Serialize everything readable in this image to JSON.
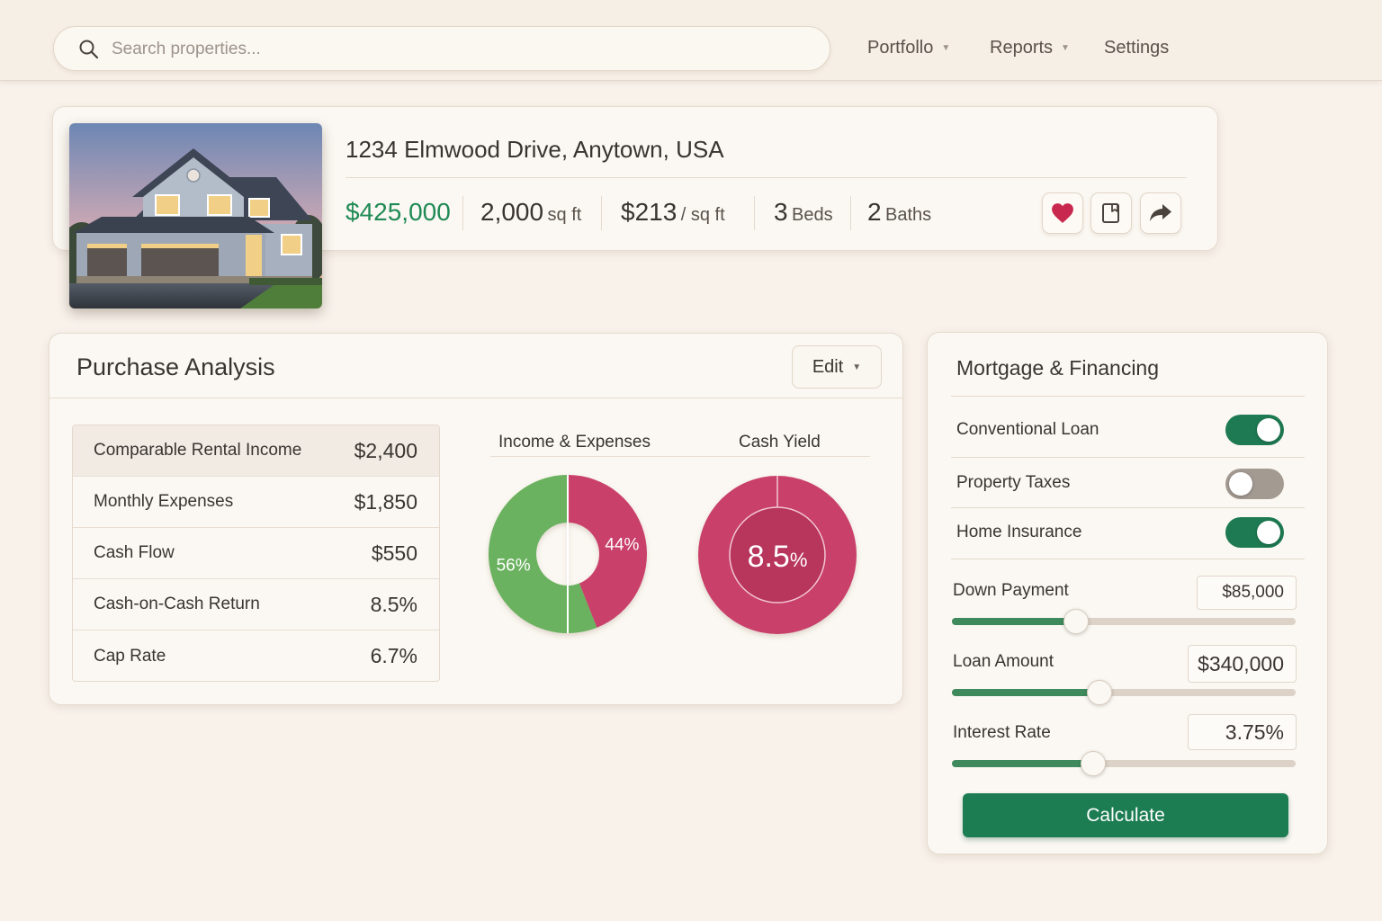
{
  "search": {
    "placeholder": "Search properties..."
  },
  "nav": {
    "portfolio": "Portfollo",
    "reports": "Reports",
    "settings": "Settings"
  },
  "property": {
    "address": "1234 Elmwood Drive, Anytown, USA",
    "price": "$425,000",
    "sqft_value": "2,000",
    "sqft_unit": "sq ft",
    "price_per_sqft": "$213",
    "price_per_sqft_unit": "/ sq ft",
    "beds_value": "3",
    "beds_unit": "Beds",
    "baths_value": "2",
    "baths_unit": "Baths",
    "photo_icon": "house-photo",
    "actions": [
      "heart-icon",
      "bookmark-icon",
      "share-icon"
    ]
  },
  "purchase_analysis": {
    "title": "Purchase Analysis",
    "edit_label": "Edit",
    "metrics": [
      {
        "label": "Comparable Rental Income",
        "value": "$2,400"
      },
      {
        "label": "Monthly Expenses",
        "value": "$1,850"
      },
      {
        "label": "Cash Flow",
        "value": "$550"
      },
      {
        "label": "Cash-on-Cash Return",
        "value": "8.5%"
      },
      {
        "label": "Cap Rate",
        "value": "6.7%"
      }
    ],
    "charts_header": {
      "income_expenses": "Income & Expenses",
      "cash_yield": "Cash Yield"
    }
  },
  "chart_data": [
    {
      "type": "pie",
      "title": "Income & Expenses",
      "donut": true,
      "slices": [
        {
          "value": 56,
          "label": "56%",
          "color": "#6ab25f"
        },
        {
          "value": 44,
          "label": "44%",
          "color": "#c9406a"
        }
      ]
    },
    {
      "type": "pie",
      "title": "Cash Yield",
      "value": 8.5,
      "label_value": "8.5",
      "label_unit": "%",
      "color": "#c9406a"
    }
  ],
  "mortgage": {
    "title": "Mortgage & Financing",
    "toggles": [
      {
        "label": "Conventional Loan",
        "on": true
      },
      {
        "label": "Property Taxes",
        "on": false
      },
      {
        "label": "Home Insurance",
        "on": true
      }
    ],
    "down_payment": {
      "label": "Down Payment",
      "value": "$85,000",
      "level": 0.36
    },
    "loan_amount": {
      "label": "Loan Amount",
      "value": "$340,000",
      "level": 0.43
    },
    "interest_rate": {
      "label": "Interest Rate",
      "value": "3.75%",
      "level": 0.41
    },
    "calculate_label": "Calculate"
  },
  "colors": {
    "accent_green": "#1c7c52",
    "price_green": "#1f8a55",
    "accent_pink": "#c9406a",
    "background": "#f8f2eb"
  }
}
